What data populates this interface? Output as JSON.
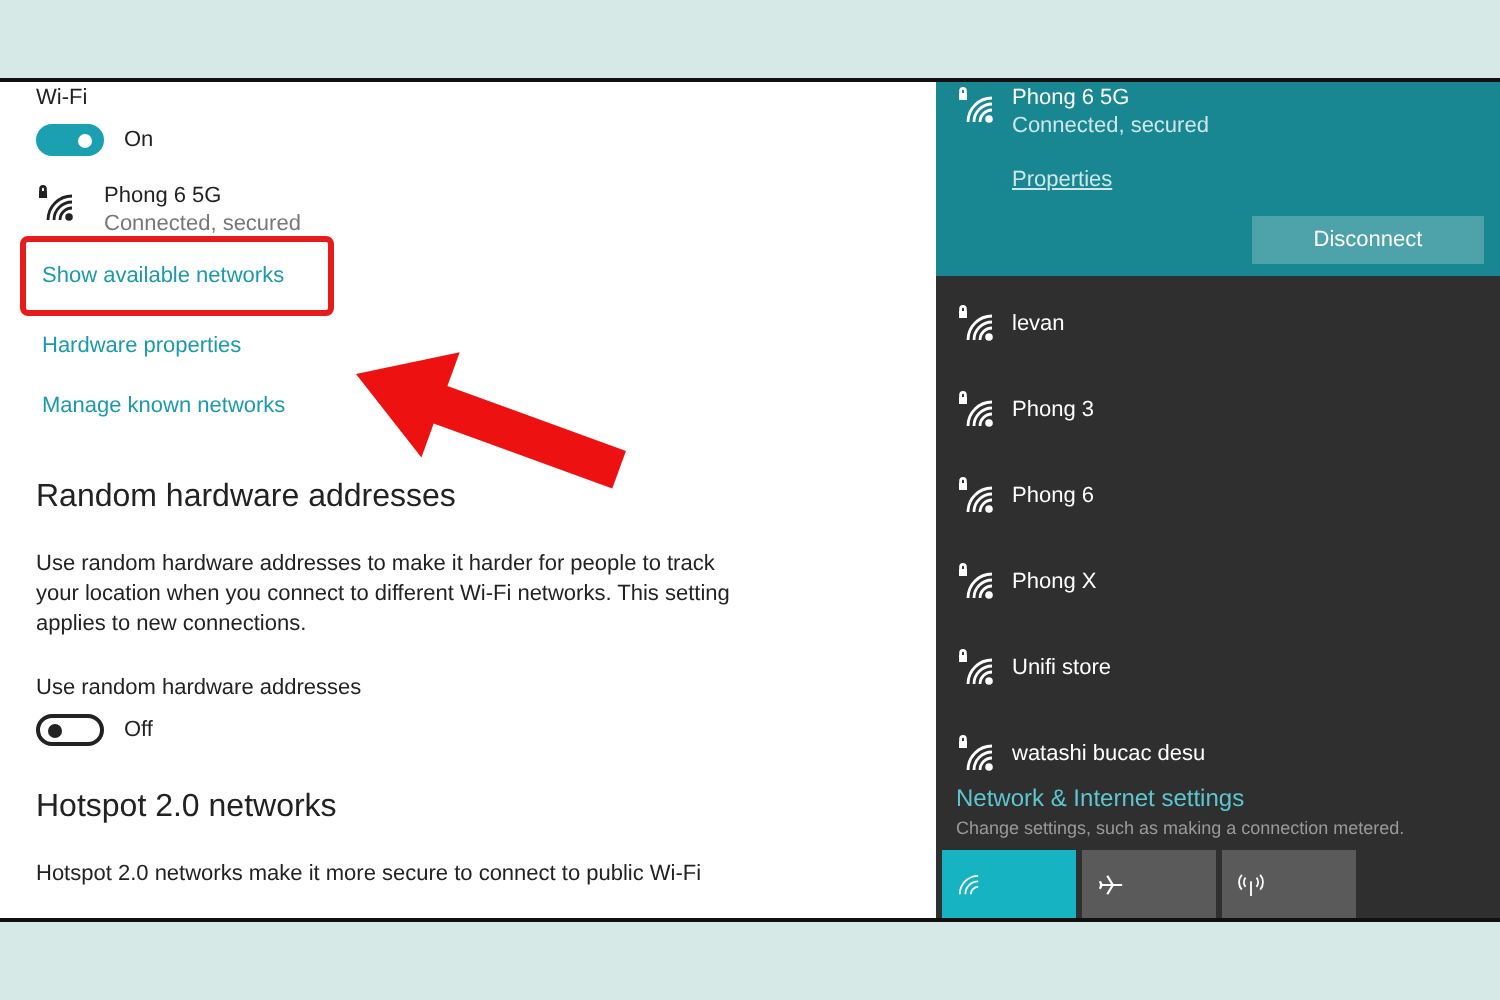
{
  "settings": {
    "wifi_label": "Wi-Fi",
    "wifi_toggle": {
      "on": true,
      "label": "On"
    },
    "connected_network": {
      "name": "Phong 6 5G",
      "status": "Connected, secured"
    },
    "links": [
      {
        "label": "Show available networks",
        "highlighted": true
      },
      {
        "label": "Hardware properties",
        "highlighted": false
      },
      {
        "label": "Manage known networks",
        "highlighted": false
      }
    ],
    "random_addresses": {
      "heading": "Random hardware addresses",
      "description": "Use random hardware addresses to make it harder for people to track your location when you connect to different Wi-Fi networks. This setting applies to new connections.",
      "label": "Use random hardware addresses",
      "toggle": {
        "on": false,
        "label": "Off"
      }
    },
    "hotspot": {
      "heading": "Hotspot 2.0 networks",
      "description": "Hotspot 2.0 networks make it more secure to connect to public Wi-Fi"
    }
  },
  "flyout": {
    "connected": {
      "name": "Phong 6 5G",
      "status": "Connected, secured",
      "properties": "Properties",
      "button": "Disconnect"
    },
    "networks": [
      {
        "name": "levan"
      },
      {
        "name": "Phong 3"
      },
      {
        "name": "Phong 6"
      },
      {
        "name": "Phong X"
      },
      {
        "name": "Unifi store"
      },
      {
        "name": "watashi bucac desu"
      }
    ],
    "settings_link": "Network & Internet settings",
    "settings_hint": "Change settings, such as making a connection metered.",
    "tiles": [
      {
        "kind": "wifi",
        "on": true
      },
      {
        "kind": "airplane",
        "on": false
      },
      {
        "kind": "mobile",
        "on": false
      }
    ]
  }
}
